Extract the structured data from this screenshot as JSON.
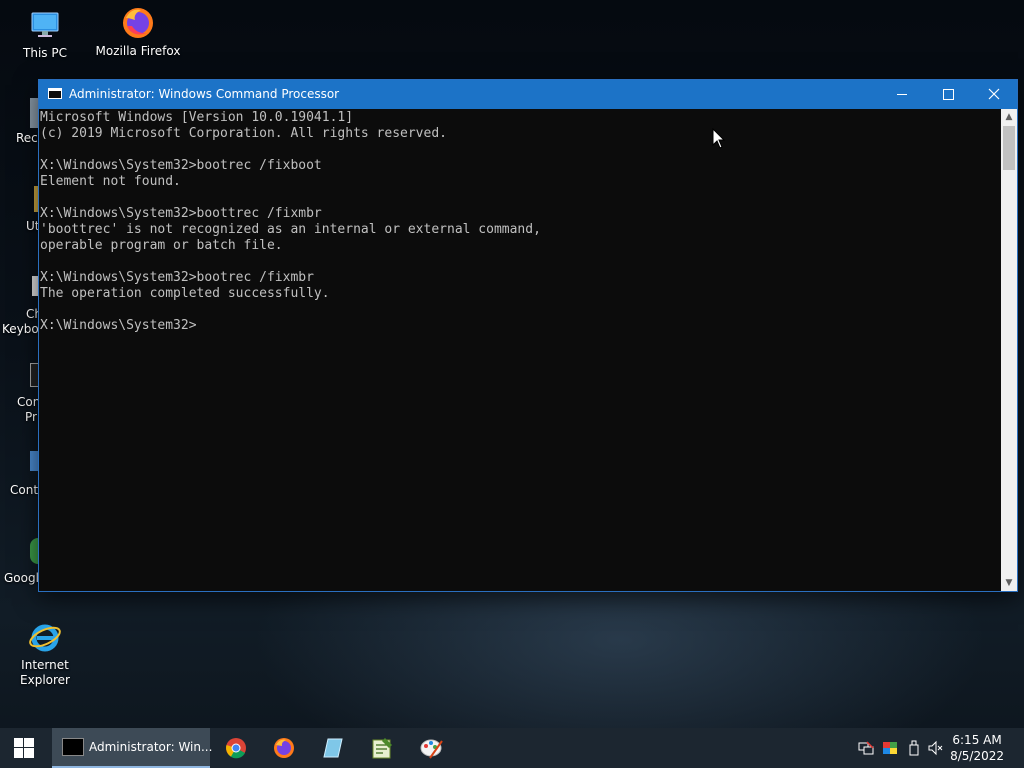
{
  "desktop": {
    "icons": [
      {
        "name": "this-pc",
        "label": "This PC"
      },
      {
        "name": "mozilla-firefox",
        "label": "Mozilla Firefox"
      },
      {
        "name": "internet-explorer",
        "label": "Internet Explorer"
      }
    ],
    "partial_labels": [
      "Recy",
      "Ut",
      "Ch",
      "Keyboa",
      "Con",
      "Pr",
      "Contr",
      "Googl"
    ]
  },
  "cmd_window": {
    "title": "Administrator: Windows Command Processor",
    "console_text": "Microsoft Windows [Version 10.0.19041.1]\n(c) 2019 Microsoft Corporation. All rights reserved.\n\nX:\\Windows\\System32>bootrec /fixboot\nElement not found.\n\nX:\\Windows\\System32>boottrec /fixmbr\n'boottrec' is not recognized as an internal or external command,\noperable program or batch file.\n\nX:\\Windows\\System32>bootrec /fixmbr\nThe operation completed successfully.\n\nX:\\Windows\\System32>",
    "buttons": {
      "minimize": "minimize",
      "maximize": "maximize",
      "close": "close"
    }
  },
  "taskbar": {
    "active_task_label": "Administrator: Win...",
    "pinned_apps": [
      "chrome-icon",
      "firefox-icon",
      "app-icon",
      "notepad-icon",
      "paint-icon"
    ],
    "clock": {
      "time": "6:15 AM",
      "date": "8/5/2022"
    },
    "tray_icons": [
      "network-icon",
      "display-icon",
      "usb-icon",
      "volume-muted-icon"
    ]
  },
  "colors": {
    "titlebar": "#1c73c7",
    "console_bg": "#0c0c0c",
    "console_text": "#c0c0c0",
    "taskbar": "#1c2630"
  }
}
